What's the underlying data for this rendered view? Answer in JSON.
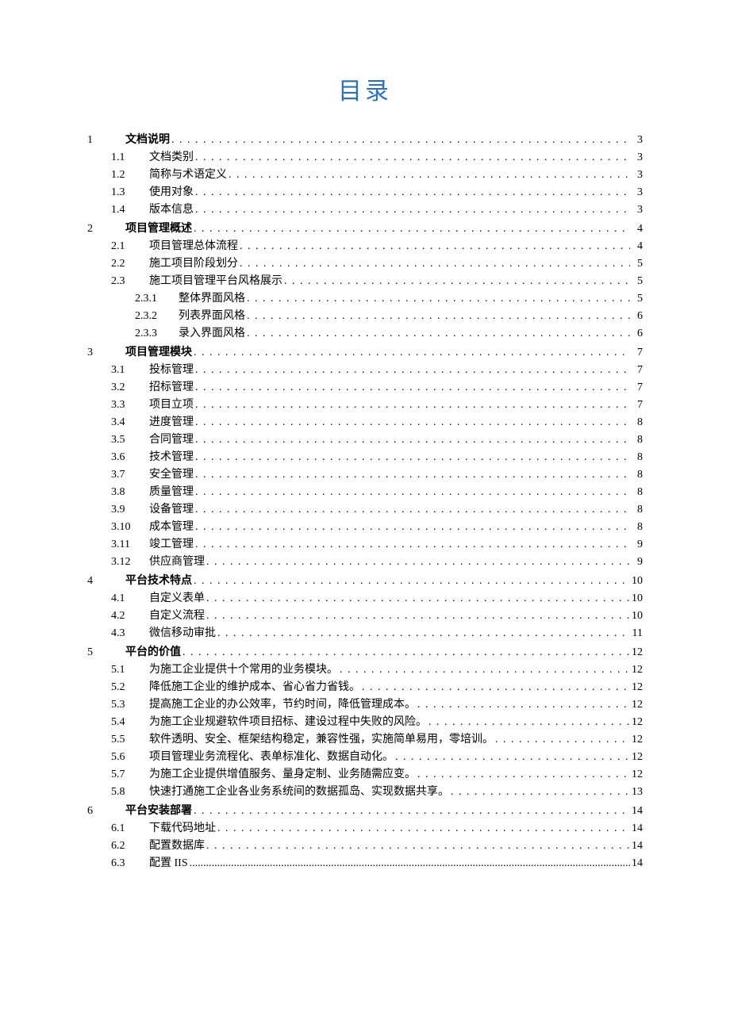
{
  "title": "目录",
  "toc": [
    {
      "level": 0,
      "num": "1",
      "text": "文档说明",
      "page": "3"
    },
    {
      "level": 1,
      "num": "1.1",
      "text": "文档类别",
      "page": "3"
    },
    {
      "level": 1,
      "num": "1.2",
      "text": "简称与术语定义",
      "page": "3"
    },
    {
      "level": 1,
      "num": "1.3",
      "text": "使用对象",
      "page": "3"
    },
    {
      "level": 1,
      "num": "1.4",
      "text": "版本信息",
      "page": "3"
    },
    {
      "level": 0,
      "num": "2",
      "text": "项目管理概述",
      "page": "4"
    },
    {
      "level": 1,
      "num": "2.1",
      "text": "项目管理总体流程",
      "page": "4"
    },
    {
      "level": 1,
      "num": "2.2",
      "text": "施工项目阶段划分",
      "page": "5"
    },
    {
      "level": 1,
      "num": "2.3",
      "text": "施工项目管理平台风格展示",
      "page": "5"
    },
    {
      "level": 2,
      "num": "2.3.1",
      "text": "整体界面风格",
      "page": "5"
    },
    {
      "level": 2,
      "num": "2.3.2",
      "text": "列表界面风格",
      "page": "6"
    },
    {
      "level": 2,
      "num": "2.3.3",
      "text": "录入界面风格",
      "page": "6"
    },
    {
      "level": 0,
      "num": "3",
      "text": "项目管理模块",
      "page": "7"
    },
    {
      "level": 1,
      "num": "3.1",
      "text": "投标管理",
      "page": "7"
    },
    {
      "level": 1,
      "num": "3.2",
      "text": "招标管理",
      "page": "7"
    },
    {
      "level": 1,
      "num": "3.3",
      "text": "项目立项",
      "page": "7"
    },
    {
      "level": 1,
      "num": "3.4",
      "text": "进度管理",
      "page": "8"
    },
    {
      "level": 1,
      "num": "3.5",
      "text": "合同管理",
      "page": "8"
    },
    {
      "level": 1,
      "num": "3.6",
      "text": "技术管理",
      "page": "8"
    },
    {
      "level": 1,
      "num": "3.7",
      "text": "安全管理",
      "page": "8"
    },
    {
      "level": 1,
      "num": "3.8",
      "text": "质量管理",
      "page": "8"
    },
    {
      "level": 1,
      "num": "3.9",
      "text": "设备管理",
      "page": "8"
    },
    {
      "level": 1,
      "num": "3.10",
      "text": "成本管理",
      "page": "8"
    },
    {
      "level": 1,
      "num": "3.11",
      "text": "竣工管理",
      "page": "9"
    },
    {
      "level": 1,
      "num": "3.12",
      "text": "供应商管理",
      "page": "9"
    },
    {
      "level": 0,
      "num": "4",
      "text": "平台技术特点",
      "page": "10"
    },
    {
      "level": 1,
      "num": "4.1",
      "text": "自定义表单",
      "page": "10"
    },
    {
      "level": 1,
      "num": "4.2",
      "text": "自定义流程",
      "page": "10"
    },
    {
      "level": 1,
      "num": "4.3",
      "text": "微信移动审批",
      "page": "11"
    },
    {
      "level": 0,
      "num": "5",
      "text": "平台的价值",
      "page": "12"
    },
    {
      "level": 1,
      "num": "5.1",
      "text": "为施工企业提供十个常用的业务模块。",
      "page": "12"
    },
    {
      "level": 1,
      "num": "5.2",
      "text": "降低施工企业的维护成本、省心省力省钱。",
      "page": "12"
    },
    {
      "level": 1,
      "num": "5.3",
      "text": "提高施工企业的办公效率，节约时间，降低管理成本。",
      "page": "12"
    },
    {
      "level": 1,
      "num": "5.4",
      "text": "为施工企业规避软件项目招标、建设过程中失败的风险。",
      "page": "12"
    },
    {
      "level": 1,
      "num": "5.5",
      "text": "软件透明、安全、框架结构稳定，兼容性强，实施简单易用，零培训。",
      "page": "12"
    },
    {
      "level": 1,
      "num": "5.6",
      "text": "项目管理业务流程化、表单标准化、数据自动化。",
      "page": "12"
    },
    {
      "level": 1,
      "num": "5.7",
      "text": "为施工企业提供增值服务、量身定制、业务随需应变。",
      "page": "12"
    },
    {
      "level": 1,
      "num": "5.8",
      "text": "快速打通施工企业各业务系统间的数据孤岛、实现数据共享。",
      "page": "13"
    },
    {
      "level": 0,
      "num": "6",
      "text": "平台安装部署",
      "page": "14"
    },
    {
      "level": 1,
      "num": "6.1",
      "text": "下载代码地址",
      "page": "14"
    },
    {
      "level": 1,
      "num": "6.2",
      "text": "配置数据库",
      "page": "14"
    },
    {
      "level": 1,
      "num": "6.3",
      "text": "配置 IIS",
      "page": "14",
      "tight": true
    }
  ]
}
